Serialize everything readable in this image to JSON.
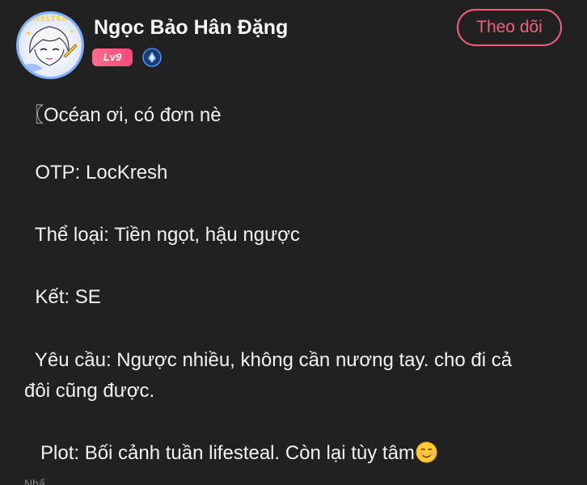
{
  "header": {
    "avatar_frame_text": "WELTER",
    "username": "Ngọc Bảo Hân Đặng",
    "level_badge": "Lv9",
    "follow_label": "Theo dõi"
  },
  "post": {
    "lines": [
      "〖Océan ơi, có đơn nè",
      "  OTP: LocKresh",
      "  Thể loại: Tiền ngọt, hậu ngược",
      "  Kết: SE",
      "  Yêu cầu: Ngược nhiều, không cần nương tay. cho đi cả",
      "đôi cũng được.",
      "   Plot: Bối cảnh tuần lifesteal. Còn lại tùy tâm"
    ],
    "trailing_emoji": "smiling-face-icon",
    "cut_off_text": "Nhấ..."
  },
  "colors": {
    "background": "#212121",
    "accent_pink": "#f0607c",
    "level_badge": "#f54a7a",
    "verify_blue": "#4a8dff"
  }
}
